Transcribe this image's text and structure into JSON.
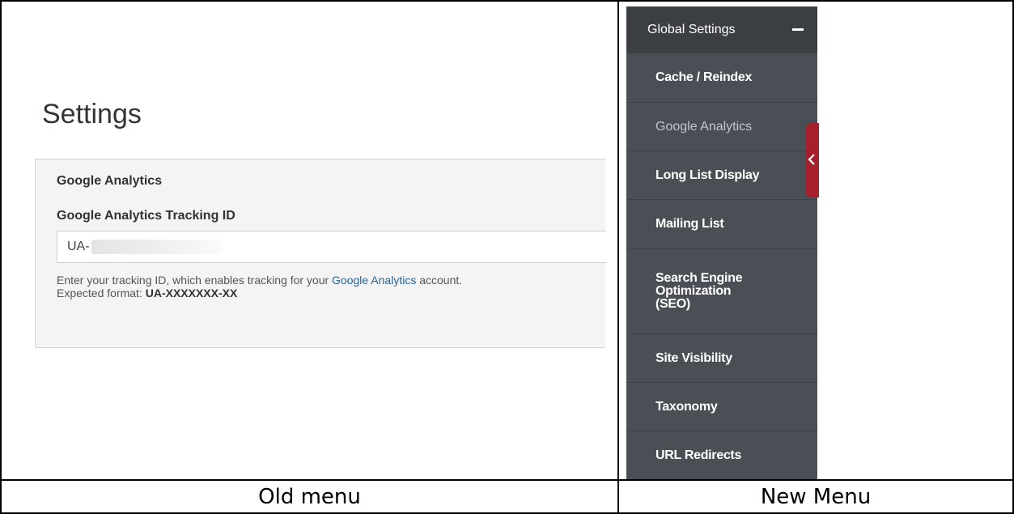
{
  "captions": {
    "old": "Old menu",
    "new": "New Menu"
  },
  "old_menu": {
    "page_title": "Settings",
    "panel_heading": "Google Analytics",
    "field_label": "Google Analytics Tracking ID",
    "field_value": "UA-",
    "help_text_before_link": "Enter your tracking ID, which enables tracking for your ",
    "help_link": "Google Analytics",
    "help_text_after_link": " account.",
    "format_label": "Expected format: ",
    "format_value": "UA-XXXXXXX-XX"
  },
  "new_menu": {
    "header": "Global Settings",
    "items": [
      {
        "label": "Cache / Reindex"
      },
      {
        "label": "Google Analytics",
        "active": true
      },
      {
        "label": "Long List Display"
      },
      {
        "label": "Mailing List"
      },
      {
        "label": "Search Engine Optimization (SEO)"
      },
      {
        "label": "Site Visibility"
      },
      {
        "label": "Taxonomy"
      },
      {
        "label": "URL Redirects"
      }
    ]
  },
  "colors": {
    "nav_bg": "#4a4f56",
    "nav_header_bg": "#3b3e43",
    "collapse_tab": "#a4212b",
    "link": "#2a6496"
  },
  "icons": {
    "header_toggle": "minus-icon",
    "collapse_tab": "chevron-left-icon"
  }
}
